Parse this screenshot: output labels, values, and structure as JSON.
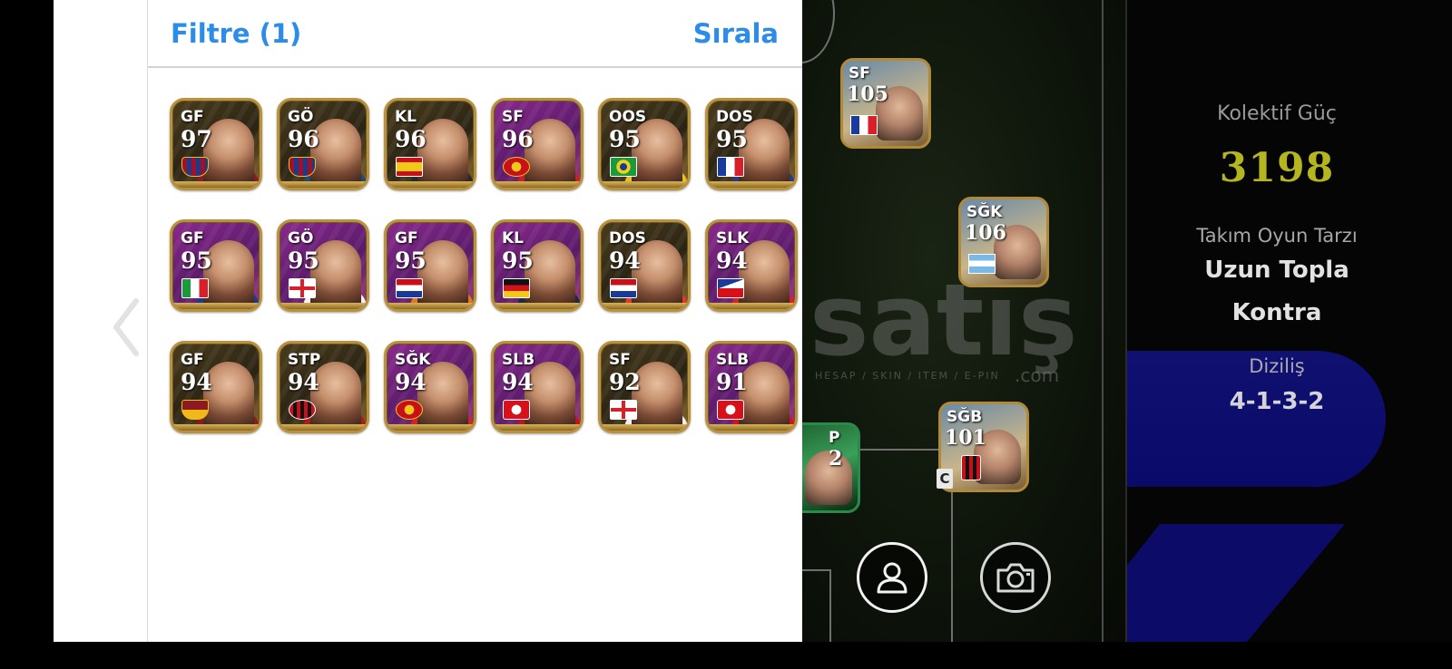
{
  "header": {
    "filter_label": "Filtre (1)",
    "sort_label": "Sırala"
  },
  "players": [
    {
      "pos": "GF",
      "rating": "97",
      "card": "gold",
      "badge": "barcelona-crest",
      "shirt": "#8a1a2a"
    },
    {
      "pos": "GÖ",
      "rating": "96",
      "card": "gold",
      "badge": "barcelona-crest",
      "shirt": "#26467a"
    },
    {
      "pos": "KL",
      "rating": "96",
      "card": "gold",
      "badge": "spain-flag",
      "shirt": "#2a2a2a"
    },
    {
      "pos": "SF",
      "rating": "96",
      "card": "purple",
      "badge": "man-utd-crest",
      "shirt": "#c8202a"
    },
    {
      "pos": "OOS",
      "rating": "95",
      "card": "gold",
      "badge": "brazil-flag",
      "shirt": "#e6c020"
    },
    {
      "pos": "DOS",
      "rating": "95",
      "card": "gold",
      "badge": "france-flag",
      "shirt": "#2a3a8a"
    },
    {
      "pos": "GF",
      "rating": "95",
      "card": "purple",
      "badge": "italy-flag",
      "shirt": "#1a3a9a"
    },
    {
      "pos": "GÖ",
      "rating": "95",
      "card": "purple",
      "badge": "england-flag",
      "shirt": "#f2f2f2"
    },
    {
      "pos": "GF",
      "rating": "95",
      "card": "purple",
      "badge": "netherlands-flag",
      "shirt": "#e07a20"
    },
    {
      "pos": "KL",
      "rating": "95",
      "card": "purple",
      "badge": "germany-flag",
      "shirt": "#1a2a4a"
    },
    {
      "pos": "DOS",
      "rating": "94",
      "card": "gold",
      "badge": "netherlands-flag",
      "shirt": "#e03a2a"
    },
    {
      "pos": "SLK",
      "rating": "94",
      "card": "purple",
      "badge": "czech-flag",
      "shirt": "#d8202a"
    },
    {
      "pos": "GF",
      "rating": "94",
      "card": "gold",
      "badge": "roma-crest",
      "shirt": "#8a1a20"
    },
    {
      "pos": "STP",
      "rating": "94",
      "card": "gold",
      "badge": "milan-crest",
      "shirt": "#b01a1a"
    },
    {
      "pos": "SĞK",
      "rating": "94",
      "card": "purple",
      "badge": "man-utd-crest",
      "shirt": "#d8202a"
    },
    {
      "pos": "SLB",
      "rating": "94",
      "card": "purple",
      "badge": "bayern-crest",
      "shirt": "#c8101a"
    },
    {
      "pos": "SF",
      "rating": "92",
      "card": "gold",
      "badge": "england-flag",
      "shirt": "#f0f0f0"
    },
    {
      "pos": "SLB",
      "rating": "91",
      "card": "purple",
      "badge": "bayern-crest",
      "shirt": "#d8101a"
    }
  ],
  "field": {
    "cards": [
      {
        "pos": "SF",
        "rating": "105",
        "flag": "france-flag"
      },
      {
        "pos": "SĞK",
        "rating": "106",
        "flag": "argentina-flag"
      },
      {
        "pos": "SĞB",
        "rating": "101",
        "flag": "milan-crest",
        "captain": "C"
      },
      {
        "pos": "P",
        "rating": "2",
        "flag": ""
      }
    ],
    "watermark": "satış",
    "watermark_sub": "HESAP / SKIN / ITEM / E-PIN",
    "watermark_com": ".com"
  },
  "summary": {
    "collective_label": "Kolektif Güç",
    "collective_value": "3198",
    "style_label": "Takım Oyun Tarzı",
    "style_line1": "Uzun Topla",
    "style_line2": "Kontra",
    "formation_label": "Diziliş",
    "formation_value": "4-1-3-2"
  },
  "colors": {
    "accent": "#2b8de8",
    "collective": "#b4b620",
    "card_gold_border": "#b8923c"
  },
  "icons": {
    "back": "chevron-left-icon",
    "profile": "user-icon",
    "camera": "camera-icon"
  }
}
